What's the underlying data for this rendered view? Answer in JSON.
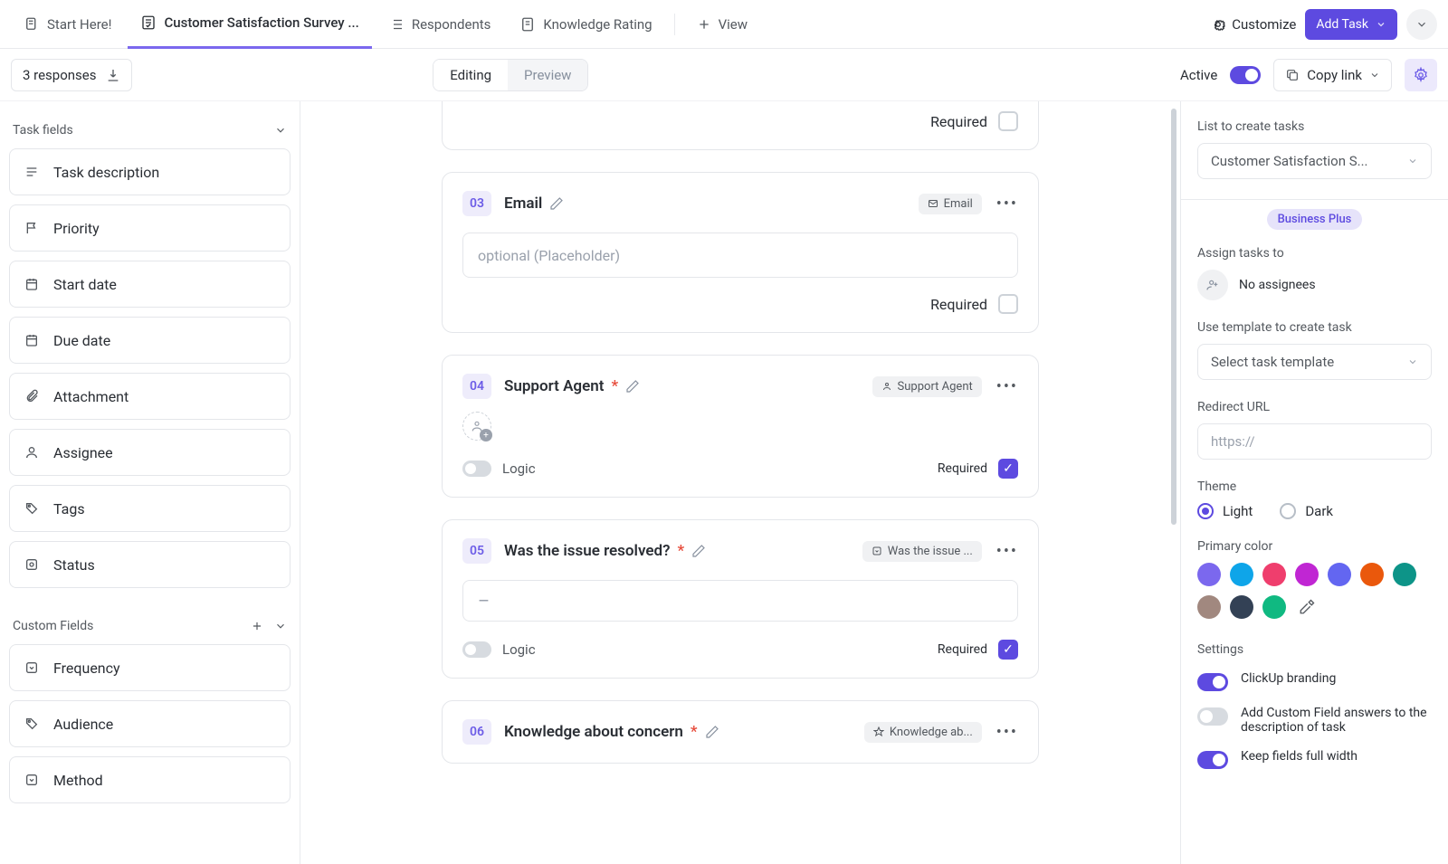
{
  "tabs": [
    {
      "label": "Start Here!"
    },
    {
      "label": "Customer Satisfaction Survey ..."
    },
    {
      "label": "Respondents"
    },
    {
      "label": "Knowledge Rating"
    },
    {
      "label": "View"
    }
  ],
  "customize_label": "Customize",
  "add_task_label": "Add Task",
  "responses_count": "3 responses",
  "editing_label": "Editing",
  "preview_label": "Preview",
  "active_label": "Active",
  "copy_link_label": "Copy link",
  "left": {
    "task_fields_label": "Task fields",
    "fields": [
      {
        "label": "Task description"
      },
      {
        "label": "Priority"
      },
      {
        "label": "Start date"
      },
      {
        "label": "Due date"
      },
      {
        "label": "Attachment"
      },
      {
        "label": "Assignee"
      },
      {
        "label": "Tags"
      },
      {
        "label": "Status"
      }
    ],
    "custom_fields_label": "Custom Fields",
    "custom": [
      {
        "label": "Frequency"
      },
      {
        "label": "Audience"
      },
      {
        "label": "Method"
      }
    ]
  },
  "cards": {
    "required_label": "Required",
    "logic_label": "Logic",
    "placeholder_text": "optional (Placeholder)",
    "c03": {
      "num": "03",
      "title": "Email",
      "chip": "Email"
    },
    "c04": {
      "num": "04",
      "title": "Support Agent",
      "chip": "Support Agent"
    },
    "c05": {
      "num": "05",
      "title": "Was the issue resolved?",
      "chip": "Was the issue ..."
    },
    "c06": {
      "num": "06",
      "title": "Knowledge about concern",
      "chip": "Knowledge ab..."
    }
  },
  "right": {
    "list_label": "List to create tasks",
    "list_value": "Customer Satisfaction S...",
    "plan_badge": "Business Plus",
    "assign_label": "Assign tasks to",
    "no_assignees": "No assignees",
    "template_label": "Use template to create task",
    "template_value": "Select task template",
    "redirect_label": "Redirect URL",
    "redirect_placeholder": "https://",
    "theme_label": "Theme",
    "theme_light": "Light",
    "theme_dark": "Dark",
    "primary_color_label": "Primary color",
    "colors": [
      "#7b68ee",
      "#0ea5e9",
      "#ef3e6d",
      "#c026d3",
      "#6366f1",
      "#ea580c",
      "#0d9488",
      "#a1887f",
      "#334155",
      "#10b981"
    ],
    "settings_label": "Settings",
    "s1": "ClickUp branding",
    "s2": "Add Custom Field answers to the description of task",
    "s3": "Keep fields full width"
  }
}
